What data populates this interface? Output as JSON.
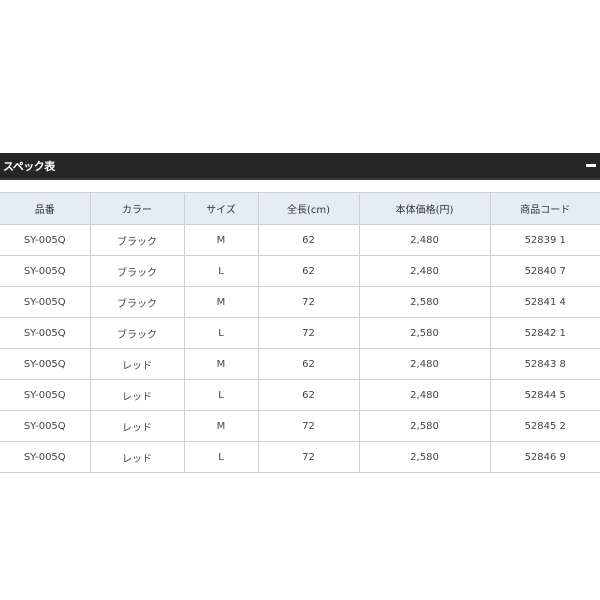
{
  "panel": {
    "title": "スペック表",
    "collapse_glyph": "−"
  },
  "table": {
    "headers": [
      "品番",
      "カラー",
      "サイズ",
      "全長(cm)",
      "本体価格(円)",
      "商品コード"
    ],
    "rows": [
      [
        "SY-005Q",
        "ブラック",
        "M",
        "62",
        "2,480",
        "52839 1"
      ],
      [
        "SY-005Q",
        "ブラック",
        "L",
        "62",
        "2,480",
        "52840 7"
      ],
      [
        "SY-005Q",
        "ブラック",
        "M",
        "72",
        "2,580",
        "52841 4"
      ],
      [
        "SY-005Q",
        "ブラック",
        "L",
        "72",
        "2,580",
        "52842 1"
      ],
      [
        "SY-005Q",
        "レッド",
        "M",
        "62",
        "2,480",
        "52843 8"
      ],
      [
        "SY-005Q",
        "レッド",
        "L",
        "62",
        "2,480",
        "52844 5"
      ],
      [
        "SY-005Q",
        "レッド",
        "M",
        "72",
        "2,580",
        "52845 2"
      ],
      [
        "SY-005Q",
        "レッド",
        "L",
        "72",
        "2,580",
        "52846 9"
      ]
    ]
  },
  "colors": {
    "header_bar": "#262626",
    "column_header_bg": "#e4ecf6",
    "border": "#d0d0d0"
  }
}
